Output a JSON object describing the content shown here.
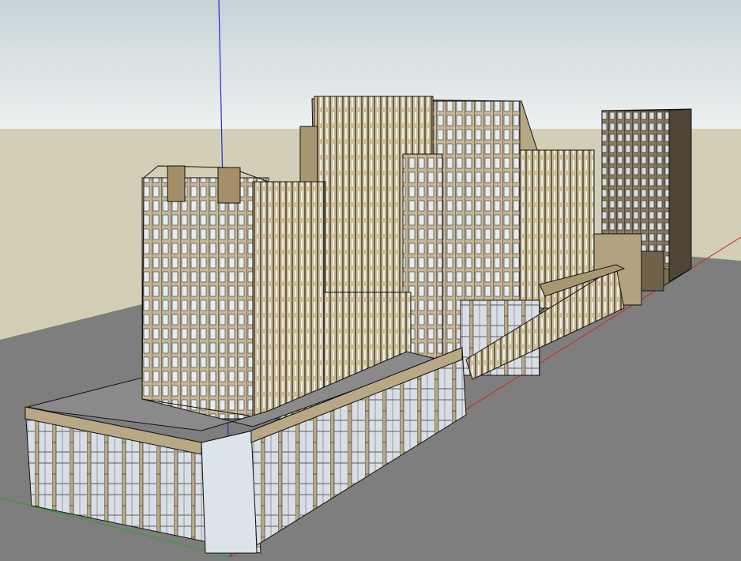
{
  "app": {
    "viewport_label": ""
  },
  "scene": {
    "sky_color_top": "#c9d6da",
    "sky_color_bottom": "#e9eeee",
    "horizon_ground_color": "#d4d0b7",
    "ground_color": "#7d7d7d",
    "facade_color": "#bfb08c",
    "facade_dark_color": "#8f7f5d",
    "glass_color": "#dfe6ee",
    "edge_color": "#1a1a1a",
    "axis_colors": {
      "blue_axis": "#1f2bd6",
      "red_axis": "#d81e1e",
      "green_axis": "#1fa81f"
    },
    "models": [
      {
        "name": "podium-block-front"
      },
      {
        "name": "tower-left"
      },
      {
        "name": "tower-center"
      },
      {
        "name": "tower-right-dark"
      },
      {
        "name": "podium-block-right"
      }
    ]
  }
}
